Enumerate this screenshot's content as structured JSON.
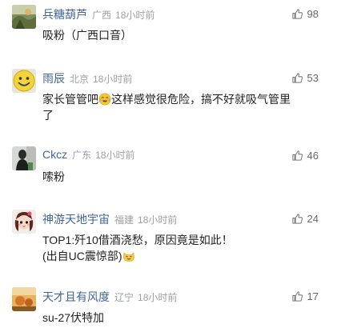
{
  "comments": [
    {
      "name": "兵糖葫芦",
      "location": "广西",
      "time": "18小时前",
      "likes": "98",
      "avatar_icon": "landscape-photo-avatar",
      "text": "吸粉（广西口音）"
    },
    {
      "name": "雨辰",
      "location": "北京",
      "time": "18小时前",
      "likes": "53",
      "avatar_icon": "smiley-face-avatar",
      "text_a": "家长管管吧",
      "emoji": "crying-laughing-emoji",
      "text_b": "这样感觉很危险，搞不好就吸气管里",
      "text_c": "了"
    },
    {
      "name": "Ckcz",
      "location": "广东",
      "time": "18小时前",
      "likes": "46",
      "avatar_icon": "dark-figure-photo-avatar",
      "text": "嗦粉"
    },
    {
      "name": "神游天地宇宙",
      "location": "福建",
      "time": "18小时前",
      "likes": "24",
      "avatar_icon": "cartoon-doll-avatar",
      "text_line1": "TOP1:歼10借酒浇愁，原因竟是如此！",
      "text_line2": "(出自UC震惊部)",
      "emoji": "cat-emoji"
    },
    {
      "name": "天才且有风度",
      "location": "辽宁",
      "time": "18小时前",
      "likes": "17",
      "avatar_icon": "orange-scene-photo-avatar",
      "text": "su-27伏特加"
    }
  ],
  "colors": {
    "name": "#406599",
    "meta": "#9aa0a6",
    "text": "#222222",
    "likes": "#666666"
  },
  "icons": {
    "like": "thumbs-up-icon"
  }
}
